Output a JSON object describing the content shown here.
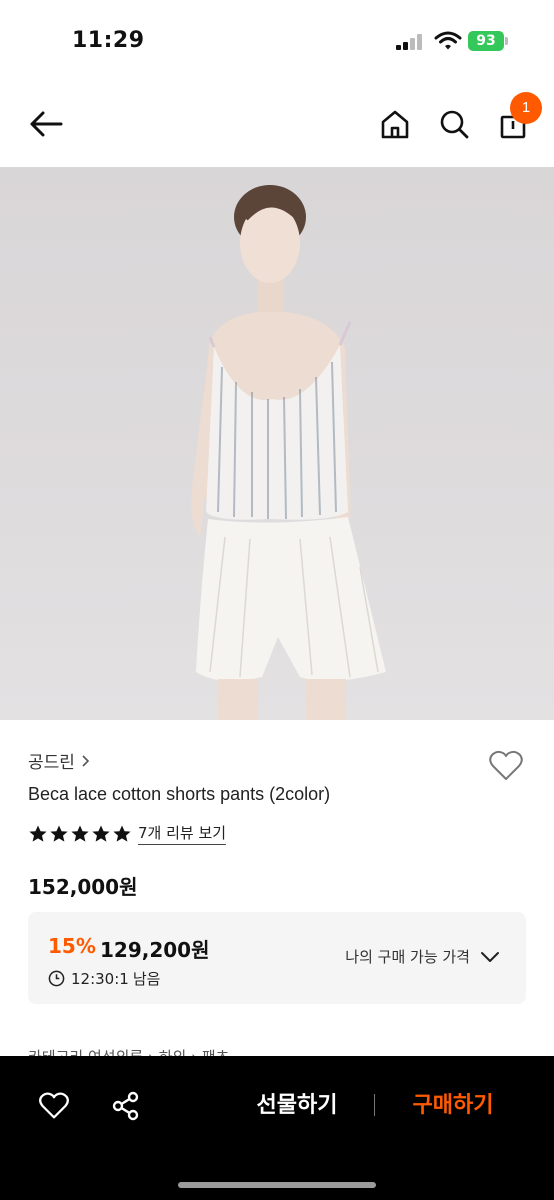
{
  "status_bar": {
    "time": "11:29",
    "battery": "93"
  },
  "nav": {
    "back_icon": "arrow-left-icon",
    "home_icon": "home-icon",
    "search_icon": "search-icon",
    "bag_icon": "shopping-bag-icon",
    "cart_count": "1",
    "badge_color": "#ff5a00"
  },
  "product": {
    "brand": "공드린",
    "title": "Beca lace cotton shorts pants (2color)",
    "rating_stars": 5,
    "review_link": "7개 리뷰 보기",
    "original_price": "152,000원",
    "discount": {
      "percent": "15%",
      "price": "129,200원",
      "timer": "12:30:1",
      "timer_suffix": "남음",
      "my_price_label": "나의 구매 가능 가격"
    },
    "cut_off_text": "카테고리      여성의류 › 하의 › 팬츠"
  },
  "bottom_bar": {
    "gift_label": "선물하기",
    "buy_label": "구매하기",
    "accent_color": "#ff5a00"
  }
}
